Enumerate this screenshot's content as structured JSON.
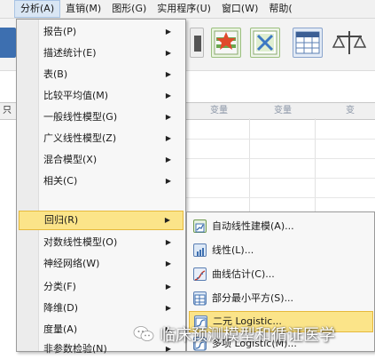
{
  "menubar": {
    "items": [
      {
        "label": "分析(A)"
      },
      {
        "label": "直销(M)"
      },
      {
        "label": "图形(G)"
      },
      {
        "label": "实用程序(U)"
      },
      {
        "label": "窗口(W)"
      },
      {
        "label": "帮助("
      }
    ]
  },
  "grid": {
    "headers": [
      "变量",
      "变量",
      "变"
    ],
    "row_label": "只"
  },
  "analyze_menu": {
    "items": [
      {
        "label": "报告(P)"
      },
      {
        "label": "描述统计(E)"
      },
      {
        "label": "表(B)"
      },
      {
        "label": "比较平均值(M)"
      },
      {
        "label": "一般线性模型(G)"
      },
      {
        "label": "广义线性模型(Z)"
      },
      {
        "label": "混合模型(X)"
      },
      {
        "label": "相关(C)"
      },
      {
        "label": "回归(R)"
      },
      {
        "label": "对数线性模型(O)"
      },
      {
        "label": "神经网络(W)"
      },
      {
        "label": "分类(F)"
      },
      {
        "label": "降维(D)"
      },
      {
        "label": "度量(A)"
      },
      {
        "label": "非参数检验(N)"
      }
    ],
    "highlighted": "回归(R)"
  },
  "regression_submenu": {
    "items": [
      {
        "label": "自动线性建模(A)..."
      },
      {
        "label": "线性(L)..."
      },
      {
        "label": "曲线估计(C)..."
      },
      {
        "label": "部分最小平方(S)..."
      },
      {
        "label": "二元 Logistic..."
      },
      {
        "label": "多项 Logistic(M)..."
      }
    ],
    "highlighted": "二元 Logistic..."
  },
  "watermark": {
    "text": "临床预测模型和循证医学"
  },
  "colors": {
    "highlight": "#fbe489",
    "highlight_border": "#e6b93b",
    "menu_bg": "#f7f7f7",
    "menubar_active": "#d9e6f4"
  }
}
